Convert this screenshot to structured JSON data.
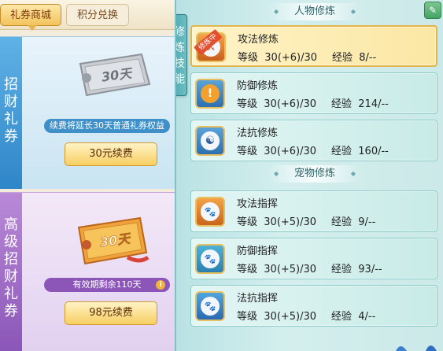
{
  "shop": {
    "tabs": [
      {
        "label": "礼券商城",
        "active": true
      },
      {
        "label": "积分兑换",
        "active": false
      }
    ],
    "cards": [
      {
        "title": "招财礼券",
        "ticket_text": "30天",
        "info": "续费将延长30天普通礼券权益",
        "button": "30元续费",
        "theme": "blue"
      },
      {
        "title": "高级招财礼券",
        "ticket_text": "30天",
        "info": "有效期剩余110天",
        "info_icon": "i",
        "button": "98元续费",
        "theme": "purple"
      }
    ]
  },
  "cultivation": {
    "side_tab": "修炼技能",
    "sections": [
      {
        "title": "人物修炼",
        "skills": [
          {
            "name": "攻法修炼",
            "level_label": "等级",
            "level": "30(+6)/30",
            "exp_label": "经验",
            "exp": "8/--",
            "badge": "修炼中",
            "selected": true,
            "icon": "attack-magic-icon",
            "glyph": "⚔"
          },
          {
            "name": "防御修炼",
            "level_label": "等级",
            "level": "30(+6)/30",
            "exp_label": "经验",
            "exp": "214/--",
            "selected": false,
            "icon": "defense-icon",
            "glyph": "!"
          },
          {
            "name": "法抗修炼",
            "level_label": "等级",
            "level": "30(+6)/30",
            "exp_label": "经验",
            "exp": "160/--",
            "selected": false,
            "icon": "magic-resist-icon",
            "glyph": "☯"
          }
        ]
      },
      {
        "title": "宠物修炼",
        "skills": [
          {
            "name": "攻法指挥",
            "level_label": "等级",
            "level": "30(+5)/30",
            "exp_label": "经验",
            "exp": "9/--",
            "selected": false,
            "icon": "pet-attack-icon",
            "glyph": "🐾"
          },
          {
            "name": "防御指挥",
            "level_label": "等级",
            "level": "30(+5)/30",
            "exp_label": "经验",
            "exp": "93/--",
            "selected": false,
            "icon": "pet-defense-icon",
            "glyph": "🐾"
          },
          {
            "name": "法抗指挥",
            "level_label": "等级",
            "level": "30(+5)/30",
            "exp_label": "经验",
            "exp": "4/--",
            "selected": false,
            "icon": "pet-resist-icon",
            "glyph": "🐾"
          }
        ]
      }
    ]
  },
  "colors": {
    "accent_gold": "#f2c35c",
    "blue_card": "#3f8fc9",
    "purple_card": "#8c56b9",
    "teal_panel": "#cbe9e8",
    "selected_border": "#e3b54a"
  }
}
